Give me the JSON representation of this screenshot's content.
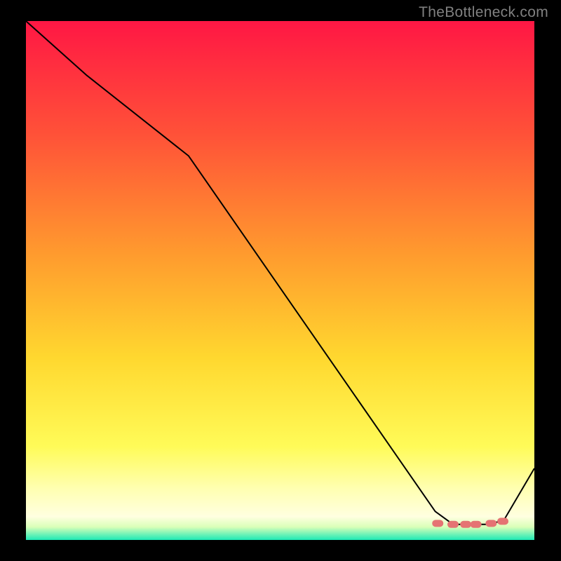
{
  "watermark": "TheBottleneck.com",
  "chart_data": {
    "type": "line",
    "title": "",
    "xlabel": "",
    "ylabel": "",
    "xlim": [
      0,
      100
    ],
    "ylim": [
      0,
      100
    ],
    "background_gradient": {
      "stops": [
        {
          "offset": 0.0,
          "color": "#ff1744"
        },
        {
          "offset": 0.22,
          "color": "#ff5238"
        },
        {
          "offset": 0.45,
          "color": "#ff9b2e"
        },
        {
          "offset": 0.65,
          "color": "#ffd82f"
        },
        {
          "offset": 0.82,
          "color": "#fffb58"
        },
        {
          "offset": 0.9,
          "color": "#ffffb0"
        },
        {
          "offset": 0.955,
          "color": "#ffffe0"
        },
        {
          "offset": 0.975,
          "color": "#d9ffb8"
        },
        {
          "offset": 1.0,
          "color": "#1de9b6"
        }
      ]
    },
    "curve": {
      "name": "bottleneck-curve",
      "color": "#000000",
      "width": 2,
      "x": [
        0.0,
        12.0,
        32.0,
        80.5,
        84.0,
        91.0,
        94.0,
        100.0
      ],
      "y": [
        100.0,
        89.5,
        74.0,
        5.5,
        3.0,
        3.0,
        3.8,
        13.8
      ]
    },
    "markers": {
      "shape": "rounded-pill",
      "color": "#e57373",
      "points": [
        {
          "x": 81.0,
          "y": 3.2
        },
        {
          "x": 84.0,
          "y": 3.0
        },
        {
          "x": 86.5,
          "y": 3.0
        },
        {
          "x": 88.5,
          "y": 3.0
        },
        {
          "x": 91.5,
          "y": 3.2
        },
        {
          "x": 93.8,
          "y": 3.6
        }
      ]
    }
  }
}
